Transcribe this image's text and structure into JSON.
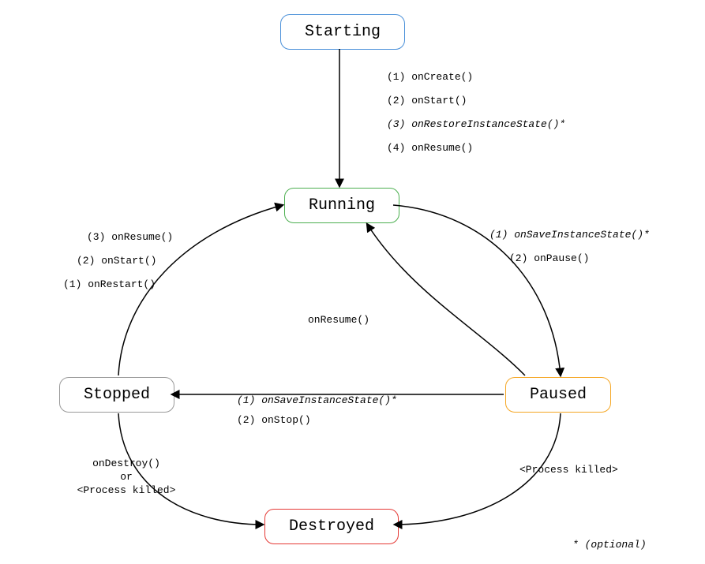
{
  "states": {
    "starting": "Starting",
    "running": "Running",
    "stopped": "Stopped",
    "paused": "Paused",
    "destroyed": "Destroyed"
  },
  "edges": {
    "start_run_1": "(1) onCreate()",
    "start_run_2": "(2) onStart()",
    "start_run_3": "(3) onRestoreInstanceState()*",
    "start_run_4": "(4) onResume()",
    "run_pause_1": "(1) onSaveInstanceState()*",
    "run_pause_2": "(2) onPause()",
    "pause_run": "onResume()",
    "pause_stop_1": "(1) onSaveInstanceState()*",
    "pause_stop_2": "(2) onStop()",
    "stop_run_1": "(1) onRestart()",
    "stop_run_2": "(2) onStart()",
    "stop_run_3": "(3) onResume()",
    "stop_dest_1": "onDestroy()",
    "stop_dest_2": "or",
    "stop_dest_3": "<Process killed>",
    "pause_dest": "<Process killed>"
  },
  "footer": "* (optional)"
}
